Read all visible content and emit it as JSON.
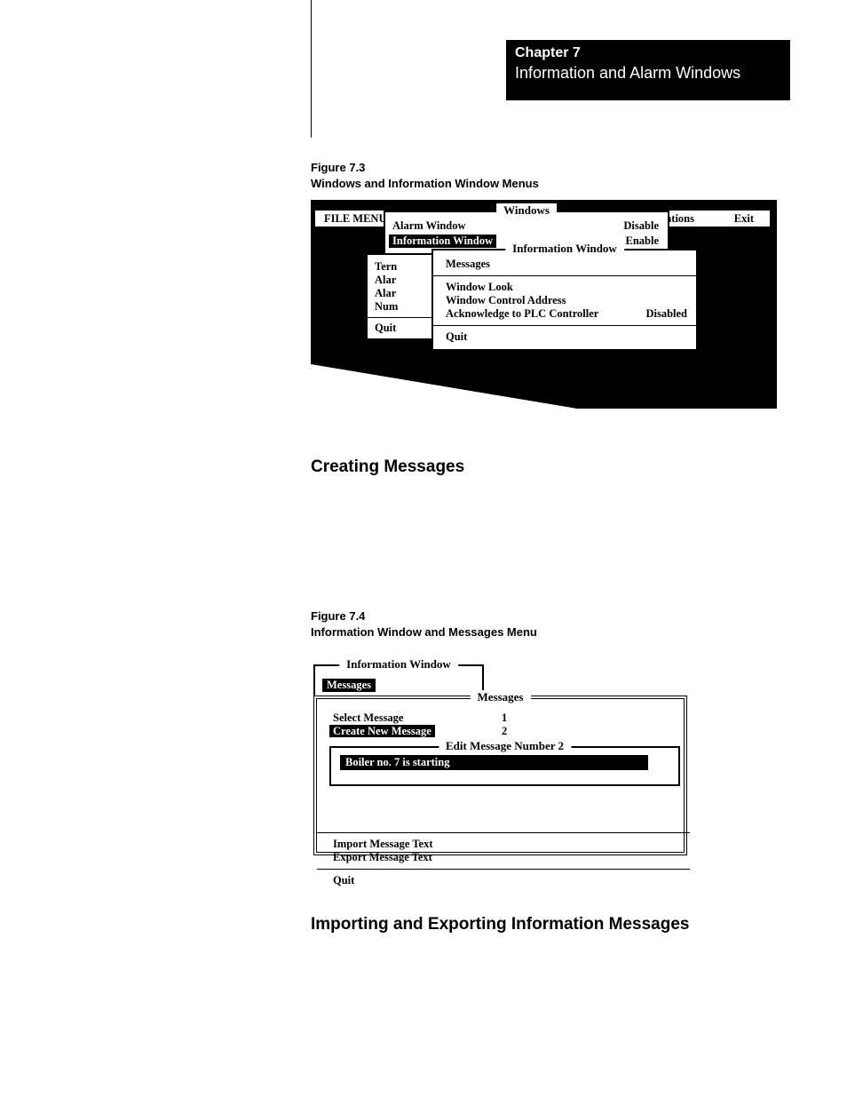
{
  "chapter": {
    "num": "Chapter 7",
    "title": "Information and Alarm Windows"
  },
  "fig73": {
    "caption_a": "Figure 7.3",
    "caption_b": "Windows and Information Window Menus",
    "menubar": {
      "file": "FILE MENU",
      "ations": "ations",
      "exit": "Exit"
    },
    "windows_box": {
      "title": "Windows",
      "row1_l": "Alarm Window",
      "row1_r": "Disable",
      "row2_l": "Information Window",
      "row2_r": "Enable"
    },
    "filesub": {
      "r1": "Tern",
      "r2": "Alar",
      "r3": "Alar",
      "r4": "Num",
      "quit": "Quit"
    },
    "infobox": {
      "title": "Information Window",
      "r1": "Messages",
      "r2": "Window Look",
      "r3": "Window Control Address",
      "r4_l": "Acknowledge to PLC Controller",
      "r4_r": "Disabled",
      "quit": "Quit"
    }
  },
  "sections": {
    "creating": "Creating Messages",
    "importing": "Importing and Exporting Information Messages"
  },
  "fig74": {
    "caption_a": "Figure 7.4",
    "caption_b": "Information Window and Messages Menu",
    "iw_title": "Information Window",
    "iw_messages": "Messages",
    "msgs_title": "Messages",
    "select_l": "Select Message",
    "select_n": "1",
    "create_l": "Create New Message",
    "create_n": "2",
    "edit_title": "Edit Message Number 2",
    "edit_value": "Boiler no. 7 is starting",
    "import": "Import Message Text",
    "export": "Export Message Text",
    "quit": "Quit"
  }
}
